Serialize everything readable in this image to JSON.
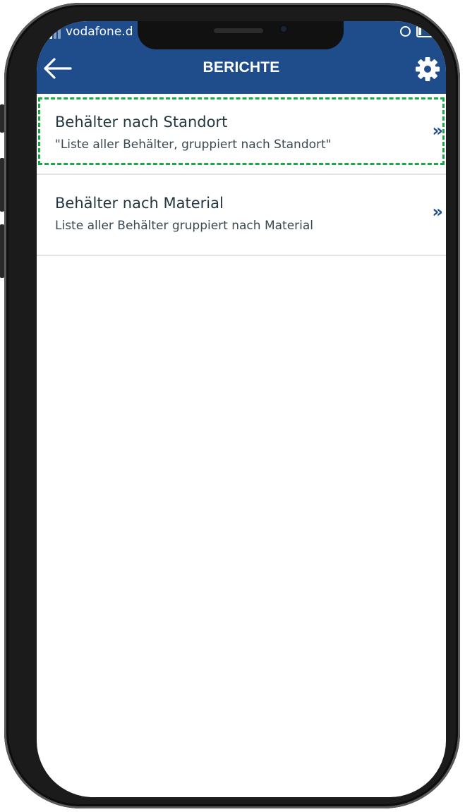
{
  "status_bar": {
    "carrier": "vodafone.d"
  },
  "app_bar": {
    "title": "BERICHTE",
    "back_icon": "arrow-left-icon",
    "settings_icon": "gear-icon",
    "background_color": "#1f4d8c"
  },
  "reports": {
    "items": [
      {
        "title": "Behälter nach Standort",
        "subtitle": "\"Liste aller Behälter, gruppiert nach Standort\"",
        "icon": "double-chevron-right-icon",
        "focused": true
      },
      {
        "title": "Behälter nach Material",
        "subtitle": "Liste aller Behälter gruppiert nach Material",
        "icon": "double-chevron-right-icon",
        "focused": false
      }
    ],
    "chevron_glyph": "»",
    "focus_color": "#1aa84b"
  }
}
